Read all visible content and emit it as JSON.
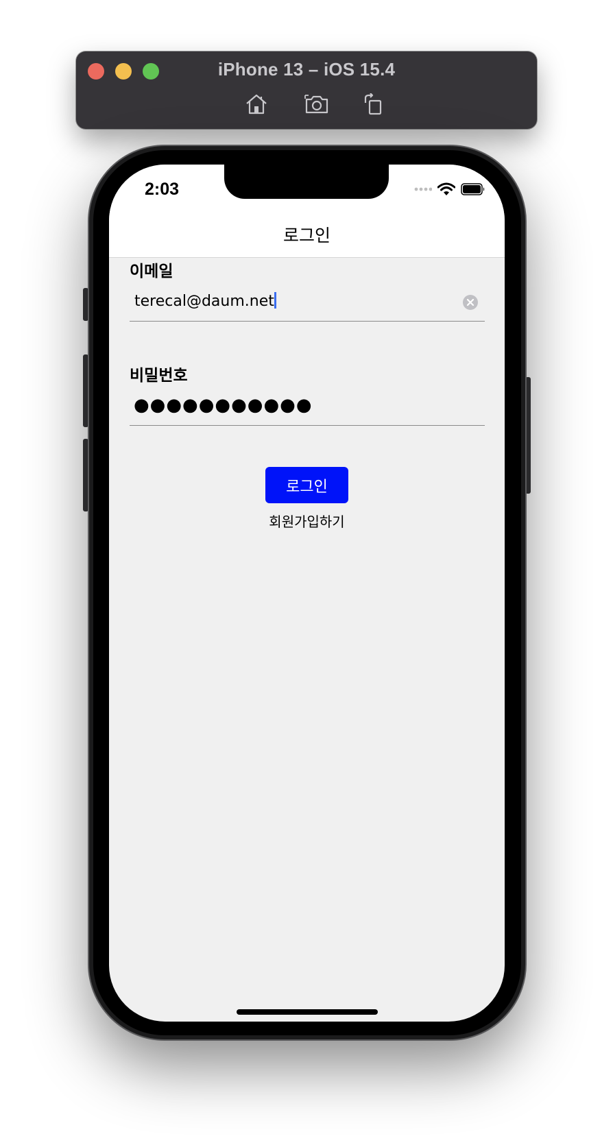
{
  "simulator": {
    "title": "iPhone 13 – iOS 15.4",
    "toolbar_icons": [
      "home-icon",
      "screenshot-icon",
      "rotate-icon"
    ]
  },
  "status_bar": {
    "time": "2:03"
  },
  "nav": {
    "title": "로그인"
  },
  "form": {
    "email_label": "이메일",
    "email_value": "terecal@daum.net",
    "password_label": "비밀번호",
    "password_mask": "●●●●●●●●●●●",
    "login_button": "로그인",
    "signup_link": "회원가입하기"
  },
  "colors": {
    "primary_button": "#0013f9",
    "screen_background": "#f0f0f0",
    "toolbar_background": "#363438"
  }
}
